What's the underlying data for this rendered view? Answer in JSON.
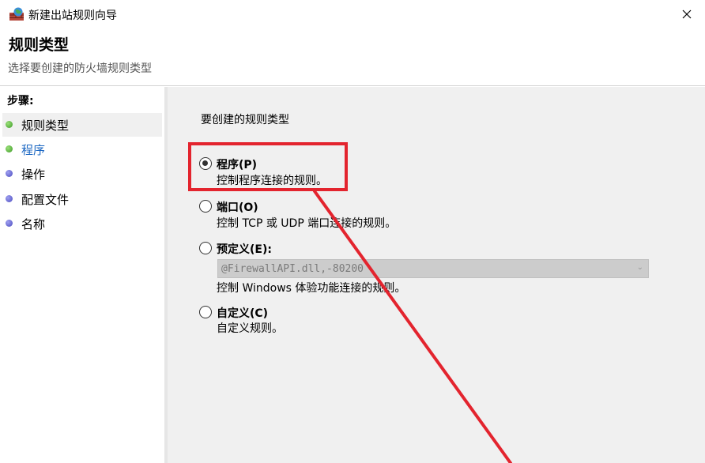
{
  "window": {
    "title": "新建出站规则向导"
  },
  "header": {
    "title": "规则类型",
    "subtitle": "选择要创建的防火墙规则类型"
  },
  "sidebar": {
    "heading": "步骤:",
    "items": [
      {
        "label": "规则类型",
        "dot": "green"
      },
      {
        "label": "程序",
        "dot": "green"
      },
      {
        "label": "操作",
        "dot": "blue"
      },
      {
        "label": "配置文件",
        "dot": "blue"
      },
      {
        "label": "名称",
        "dot": "blue"
      }
    ]
  },
  "main": {
    "prompt": "要创建的规则类型",
    "options": [
      {
        "title": "程序(P)",
        "desc": "控制程序连接的规则。",
        "checked": true
      },
      {
        "title": "端口(O)",
        "desc": "控制 TCP 或 UDP 端口连接的规则。",
        "checked": false
      },
      {
        "title": "预定义(E):",
        "desc": "控制 Windows 体验功能连接的规则。",
        "checked": false
      },
      {
        "title": "自定义(C)",
        "desc": "自定义规则。",
        "checked": false
      }
    ],
    "predefined_combo": {
      "value": "@FirewallAPI.dll,-80200",
      "disabled": true
    }
  },
  "colors": {
    "annotation": "#e3242e",
    "content_bg": "#f0f0f0",
    "link": "#1a66c2"
  }
}
